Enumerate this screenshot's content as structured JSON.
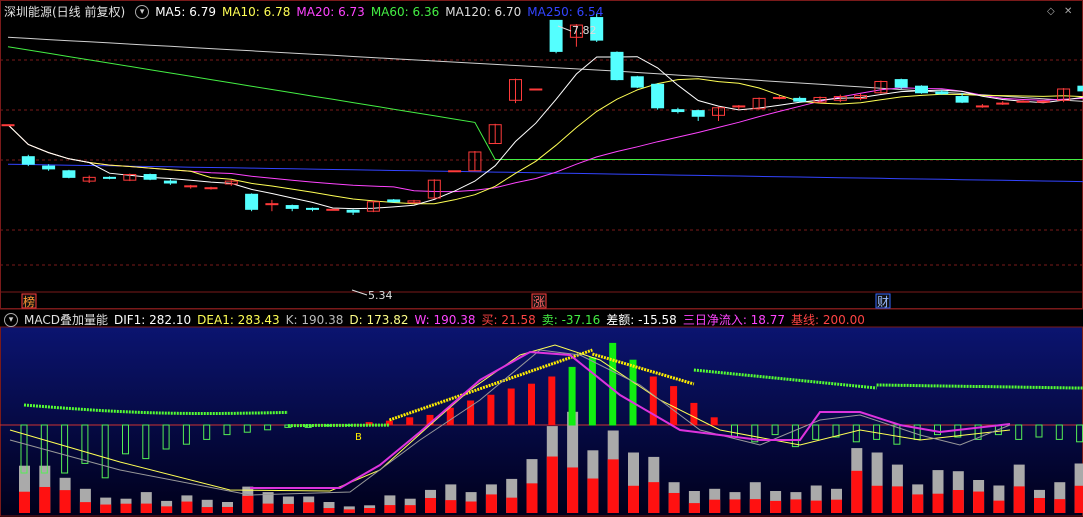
{
  "header": {
    "stock_name": "深圳能源(日线 前复权)",
    "ma": [
      {
        "label": "MA5: 6.79",
        "color": "#ffffff"
      },
      {
        "label": "MA10: 6.78",
        "color": "#ffff55"
      },
      {
        "label": "MA20: 6.73",
        "color": "#ff44ff"
      },
      {
        "label": "MA60: 6.36",
        "color": "#44ee44"
      },
      {
        "label": "MA120: 6.70",
        "color": "#dddddd"
      },
      {
        "label": "MA250: 6.54",
        "color": "#3344ff"
      }
    ]
  },
  "sub_header": {
    "indicator_name": "MACD叠加量能",
    "items": [
      {
        "label": "DIF1: 282.10",
        "color": "#ffffff"
      },
      {
        "label": "DEA1: 283.43",
        "color": "#ffff55"
      },
      {
        "label": "K: 190.38",
        "color": "#bbbbbb"
      },
      {
        "label": "D: 173.82",
        "color": "#ffff88"
      },
      {
        "label": "W: 190.38",
        "color": "#ff44ff"
      },
      {
        "label": "买: 21.58",
        "color": "#ff4444"
      },
      {
        "label": "卖: -37.16",
        "color": "#44ee44"
      },
      {
        "label": "差额: -15.58",
        "color": "#ffffff"
      },
      {
        "label": "三日净流入: 18.77",
        "color": "#ff44ff"
      },
      {
        "label": "基线: 200.00",
        "color": "#ff4444"
      }
    ]
  },
  "annotations": {
    "high_label": "7.82",
    "low_label": "5.34",
    "tag_left": "榜",
    "tag_mid": "涨",
    "tag_right": "财",
    "b_marker": "B"
  },
  "colors": {
    "up": "#ff3b3b",
    "down": "#54ffff",
    "grid": "#7a1a1a",
    "macd_top": "#0b1470",
    "macd_bottom": "#00001a"
  },
  "chart_data": {
    "type": "candlestick",
    "candles": [
      [
        6.62,
        6.62,
        6.6,
        6.6
      ],
      [
        6.28,
        6.2,
        6.3,
        6.18
      ],
      [
        6.18,
        6.15,
        6.2,
        6.13
      ],
      [
        6.13,
        6.06,
        6.14,
        6.05
      ],
      [
        6.02,
        6.06,
        6.08,
        6.0
      ],
      [
        6.06,
        6.05,
        6.07,
        6.04
      ],
      [
        6.03,
        6.09,
        6.1,
        6.02
      ],
      [
        6.09,
        6.04,
        6.1,
        6.03
      ],
      [
        6.02,
        6.0,
        6.04,
        5.98
      ],
      [
        5.96,
        5.97,
        5.98,
        5.94
      ],
      [
        5.94,
        5.95,
        5.96,
        5.93
      ],
      [
        5.99,
        6.02,
        6.03,
        5.97
      ],
      [
        5.88,
        5.72,
        5.89,
        5.7
      ],
      [
        5.78,
        5.78,
        5.82,
        5.7
      ],
      [
        5.76,
        5.73,
        5.77,
        5.7
      ],
      [
        5.73,
        5.72,
        5.74,
        5.7
      ],
      [
        5.72,
        5.72,
        5.72,
        5.72
      ],
      [
        5.71,
        5.69,
        5.72,
        5.66
      ],
      [
        5.7,
        5.8,
        5.81,
        5.69
      ],
      [
        5.82,
        5.8,
        5.83,
        5.79
      ],
      [
        5.79,
        5.81,
        5.82,
        5.78
      ],
      [
        5.84,
        6.03,
        6.04,
        5.84
      ],
      [
        6.13,
        6.13,
        6.13,
        6.13
      ],
      [
        6.13,
        6.33,
        6.34,
        6.13
      ],
      [
        6.42,
        6.62,
        6.63,
        6.42
      ],
      [
        6.88,
        7.1,
        7.11,
        6.85
      ],
      [
        7.0,
        7.0,
        7.0,
        7.0
      ],
      [
        7.73,
        7.4,
        7.73,
        7.38
      ],
      [
        7.55,
        7.68,
        7.69,
        7.45
      ],
      [
        7.76,
        7.52,
        7.8,
        7.5
      ],
      [
        7.39,
        7.1,
        7.4,
        7.09
      ],
      [
        7.13,
        7.02,
        7.14,
        7.01
      ],
      [
        7.05,
        6.8,
        7.06,
        6.78
      ],
      [
        6.78,
        6.76,
        6.8,
        6.74
      ],
      [
        6.77,
        6.71,
        6.78,
        6.66
      ],
      [
        6.72,
        6.8,
        6.81,
        6.66
      ],
      [
        6.81,
        6.82,
        6.83,
        6.78
      ],
      [
        6.79,
        6.9,
        6.91,
        6.78
      ],
      [
        6.91,
        6.91,
        6.93,
        6.89
      ],
      [
        6.9,
        6.87,
        6.92,
        6.86
      ],
      [
        6.86,
        6.91,
        6.92,
        6.85
      ],
      [
        6.88,
        6.92,
        6.94,
        6.86
      ],
      [
        6.9,
        6.93,
        6.95,
        6.88
      ],
      [
        6.96,
        7.08,
        7.09,
        6.95
      ],
      [
        7.1,
        7.02,
        7.11,
        7.0
      ],
      [
        7.03,
        6.96,
        7.04,
        6.95
      ],
      [
        6.97,
        6.95,
        6.99,
        6.94
      ],
      [
        6.92,
        6.86,
        6.96,
        6.85
      ],
      [
        6.82,
        6.82,
        6.84,
        6.8
      ],
      [
        6.84,
        6.85,
        6.87,
        6.83
      ],
      [
        6.87,
        6.87,
        6.88,
        6.86
      ],
      [
        6.87,
        6.87,
        6.88,
        6.86
      ],
      [
        6.88,
        7.0,
        7.01,
        6.86
      ],
      [
        7.03,
        6.98,
        7.15,
        6.97
      ]
    ],
    "high": 7.82,
    "low": 5.34,
    "volume": [
      [
        0.43,
        0
      ],
      [
        0.43,
        0
      ],
      [
        0.32,
        0
      ],
      [
        0.22,
        1
      ],
      [
        0.14,
        1
      ],
      [
        0.13,
        1
      ],
      [
        0.19,
        1
      ],
      [
        0.11,
        1
      ],
      [
        0.16,
        1
      ],
      [
        0.12,
        1
      ],
      [
        0.1,
        1
      ],
      [
        0.24,
        1
      ],
      [
        0.19,
        1
      ],
      [
        0.15,
        1
      ],
      [
        0.15,
        1
      ],
      [
        0.1,
        1
      ],
      [
        0.06,
        1
      ],
      [
        0.07,
        1
      ],
      [
        0.16,
        0
      ],
      [
        0.13,
        0
      ],
      [
        0.21,
        0
      ],
      [
        0.26,
        0
      ],
      [
        0.19,
        0
      ],
      [
        0.26,
        0
      ],
      [
        0.31,
        0
      ],
      [
        0.49,
        0
      ],
      [
        0.79,
        0
      ],
      [
        0.92,
        0
      ],
      [
        0.57,
        0
      ],
      [
        0.75,
        0
      ],
      [
        0.55,
        0
      ],
      [
        0.51,
        0
      ],
      [
        0.28,
        0
      ],
      [
        0.2,
        0
      ],
      [
        0.22,
        0
      ],
      [
        0.19,
        0
      ],
      [
        0.28,
        0
      ],
      [
        0.2,
        0
      ],
      [
        0.19,
        0
      ],
      [
        0.25,
        0
      ],
      [
        0.22,
        0
      ],
      [
        0.59,
        0
      ],
      [
        0.55,
        0
      ],
      [
        0.44,
        0
      ],
      [
        0.26,
        0
      ],
      [
        0.39,
        0
      ],
      [
        0.38,
        0
      ],
      [
        0.3,
        0
      ],
      [
        0.25,
        0
      ],
      [
        0.44,
        0
      ],
      [
        0.21,
        0
      ],
      [
        0.28,
        0
      ],
      [
        0.45,
        0
      ],
      [
        0.53,
        0
      ]
    ]
  }
}
